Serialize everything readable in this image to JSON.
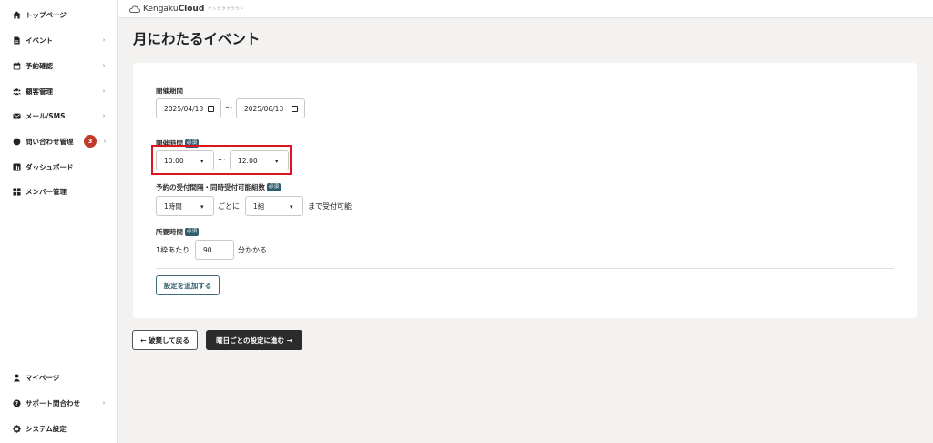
{
  "sidebar": {
    "items": [
      {
        "label": "トップページ",
        "icon": "home-icon",
        "has_chevron": false
      },
      {
        "label": "イベント",
        "icon": "document-icon",
        "has_chevron": true
      },
      {
        "label": "予約確認",
        "icon": "calendar-icon",
        "has_chevron": true
      },
      {
        "label": "顧客管理",
        "icon": "users-icon",
        "has_chevron": true
      },
      {
        "label": "メール/SMS",
        "icon": "mail-icon",
        "has_chevron": true
      },
      {
        "label": "問い合わせ管理",
        "icon": "chat-icon",
        "has_chevron": true,
        "badge": "3"
      },
      {
        "label": "ダッシュボード",
        "icon": "chart-icon",
        "has_chevron": false
      },
      {
        "label": "メンバー管理",
        "icon": "grid-icon",
        "has_chevron": false
      }
    ],
    "bottom_items": [
      {
        "label": "マイページ",
        "icon": "person-icon",
        "has_chevron": false
      },
      {
        "label": "サポート問合わせ",
        "icon": "help-icon",
        "has_chevron": true
      },
      {
        "label": "システム設定",
        "icon": "gear-icon",
        "has_chevron": false
      }
    ]
  },
  "header": {
    "logo_main": "Kengaku",
    "logo_bold": "Cloud",
    "logo_sub": "ケンガククラウド"
  },
  "page": {
    "title": "月にわたるイベント"
  },
  "form": {
    "period": {
      "label": "開催期間",
      "start": "2025/04/13",
      "end": "2025/06/13",
      "separator": "〜"
    },
    "time": {
      "label": "開催時間",
      "required": "必須",
      "start": "10:00",
      "end": "12:00",
      "separator": "〜"
    },
    "interval": {
      "label": "予約の受付間隔・同時受付可能組数",
      "required": "必須",
      "interval_value": "1時間",
      "mid_text": "ごとに",
      "groups_value": "1組",
      "suffix": "まで受付可能"
    },
    "duration": {
      "label": "所要時間",
      "required": "必須",
      "prefix": "1枠あたり",
      "value": "90",
      "suffix": "分かかる"
    },
    "add_button": "設定を追加する"
  },
  "actions": {
    "back": "← 破棄して戻る",
    "next": "曜日ごとの設定に進む →"
  },
  "colors": {
    "accent": "#2f5d6e",
    "badge": "#c0392b",
    "highlight": "#e0141e",
    "primary_button": "#2b2b2b"
  }
}
